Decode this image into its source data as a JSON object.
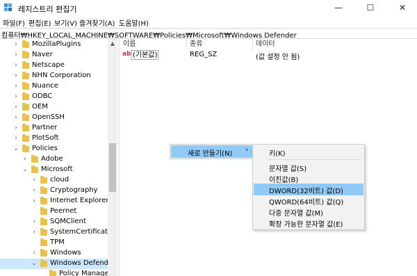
{
  "window": {
    "title": "레지스트리 편집기",
    "controls": {
      "minimize": "—",
      "maximize": "☐",
      "close": "✕"
    }
  },
  "menu": [
    "파일(F)",
    "편집(E)",
    "보기(V)",
    "즐겨찾기(A)",
    "도움말(H)"
  ],
  "address": "컴퓨터₩HKEY_LOCAL_MACHINE₩SOFTWARE₩Policies₩Microsoft₩Windows Defender",
  "tree": {
    "items": [
      {
        "label": "MozillaPlugins",
        "chevron": "›",
        "depth": 2
      },
      {
        "label": "Naver",
        "chevron": "›",
        "depth": 2
      },
      {
        "label": "Netscape",
        "chevron": "›",
        "depth": 2
      },
      {
        "label": "NHN Corporation",
        "chevron": "›",
        "depth": 2
      },
      {
        "label": "Nuance",
        "chevron": "›",
        "depth": 2
      },
      {
        "label": "ODBC",
        "chevron": "›",
        "depth": 2
      },
      {
        "label": "OEM",
        "chevron": "›",
        "depth": 2
      },
      {
        "label": "OpenSSH",
        "chevron": "›",
        "depth": 2
      },
      {
        "label": "Partner",
        "chevron": "›",
        "depth": 2
      },
      {
        "label": "PlotSoft",
        "chevron": "›",
        "depth": 2
      },
      {
        "label": "Policies",
        "chevron": "⌄",
        "depth": 2
      },
      {
        "label": "Adobe",
        "chevron": "›",
        "depth": 3
      },
      {
        "label": "Microsoft",
        "chevron": "⌄",
        "depth": 3
      },
      {
        "label": "cloud",
        "chevron": "›",
        "depth": 4
      },
      {
        "label": "Cryptography",
        "chevron": "›",
        "depth": 4
      },
      {
        "label": "Internet Explorer",
        "chevron": "›",
        "depth": 4
      },
      {
        "label": "Peernet",
        "chevron": "",
        "depth": 4
      },
      {
        "label": "SQMClient",
        "chevron": "›",
        "depth": 4
      },
      {
        "label": "SystemCertificates",
        "chevron": "›",
        "depth": 4
      },
      {
        "label": "TPM",
        "chevron": "",
        "depth": 4
      },
      {
        "label": "Windows",
        "chevron": "›",
        "depth": 4
      },
      {
        "label": "Windows Defender",
        "chevron": "⌄",
        "depth": 4,
        "selected": true
      },
      {
        "label": "Policy Manager",
        "chevron": "",
        "depth": 5
      }
    ]
  },
  "list": {
    "columns": [
      "이름",
      "종류",
      "데이터"
    ],
    "rows": [
      {
        "icon": "ab",
        "name": "(기본값)",
        "type": "REG_SZ",
        "data": "(값 설정 안 됨)"
      }
    ]
  },
  "context_menu": {
    "item": "새로 만들기(N)",
    "arrow": "›"
  },
  "submenu": {
    "items": [
      {
        "label": "키(K)"
      },
      {
        "separator": true
      },
      {
        "label": "문자열 값(S)"
      },
      {
        "label": "이진값(B)"
      },
      {
        "label": "DWORD(32비트) 값(D)",
        "highlighted": true
      },
      {
        "label": "QWORD(64비트) 값(Q)"
      },
      {
        "label": "다중 문자열 값(M)"
      },
      {
        "label": "확장 가능한 문자열 값(E)"
      }
    ]
  },
  "colors": {
    "folder": "#e8c24a",
    "selection": "#cce8ff",
    "menu_highlight": "#91c9f7"
  }
}
